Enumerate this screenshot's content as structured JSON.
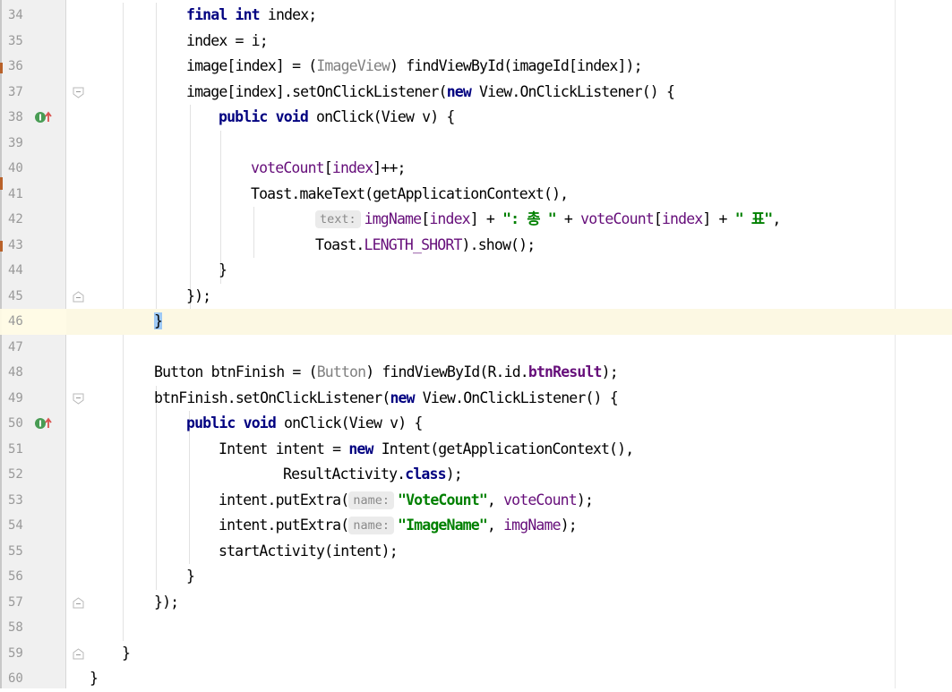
{
  "editor": {
    "language": "java",
    "caret_line": 46,
    "lines": [
      {
        "n": "34",
        "indent": 3,
        "tokens": [
          {
            "t": "final",
            "c": "k"
          },
          {
            "t": " "
          },
          {
            "t": "int",
            "c": "k"
          },
          {
            "t": " index;"
          }
        ]
      },
      {
        "n": "35",
        "indent": 3,
        "tokens": [
          {
            "t": "index = i;"
          }
        ]
      },
      {
        "n": "36",
        "indent": 3,
        "tokens": [
          {
            "t": "image[index] = ("
          },
          {
            "t": "ImageView",
            "c": "c"
          },
          {
            "t": ") findViewById(imageId[index]);"
          }
        ]
      },
      {
        "n": "37",
        "indent": 3,
        "fold": "open",
        "tokens": [
          {
            "t": "image[index].setOnClickListener("
          },
          {
            "t": "new",
            "c": "k"
          },
          {
            "t": " View.OnClickListener() {"
          }
        ]
      },
      {
        "n": "38",
        "indent": 4,
        "override": true,
        "tokens": [
          {
            "t": "public",
            "c": "k"
          },
          {
            "t": " "
          },
          {
            "t": "void",
            "c": "k"
          },
          {
            "t": " onClick(View v) {"
          }
        ]
      },
      {
        "n": "39",
        "indent": 0,
        "tokens": []
      },
      {
        "n": "40",
        "indent": 5,
        "tokens": [
          {
            "t": "voteCount",
            "c": "f"
          },
          {
            "t": "["
          },
          {
            "t": "index",
            "c": "f"
          },
          {
            "t": "]++;"
          }
        ]
      },
      {
        "n": "41",
        "indent": 5,
        "tokens": [
          {
            "t": "Toast.makeText(getApplicationContext(),"
          }
        ]
      },
      {
        "n": "42",
        "indent": 7,
        "tokens": [
          {
            "t": "text:",
            "c": "hint"
          },
          {
            "t": "imgName",
            "c": "f"
          },
          {
            "t": "["
          },
          {
            "t": "index",
            "c": "f"
          },
          {
            "t": "] + "
          },
          {
            "t": "\": 총 \"",
            "c": "s"
          },
          {
            "t": " + "
          },
          {
            "t": "voteCount",
            "c": "f"
          },
          {
            "t": "["
          },
          {
            "t": "index",
            "c": "f"
          },
          {
            "t": "] + "
          },
          {
            "t": "\" 표\"",
            "c": "s"
          },
          {
            "t": ","
          }
        ]
      },
      {
        "n": "43",
        "indent": 7,
        "tokens": [
          {
            "t": "Toast."
          },
          {
            "t": "LENGTH_SHORT",
            "c": "f"
          },
          {
            "t": ").show();"
          }
        ]
      },
      {
        "n": "44",
        "indent": 4,
        "tokens": [
          {
            "t": "}"
          }
        ]
      },
      {
        "n": "45",
        "indent": 3,
        "fold": "close",
        "tokens": [
          {
            "t": "});"
          }
        ]
      },
      {
        "n": "46",
        "indent": 2,
        "caret": true,
        "tokens": [
          {
            "t": "}",
            "c": "caret-brace"
          }
        ]
      },
      {
        "n": "47",
        "indent": 0,
        "tokens": []
      },
      {
        "n": "48",
        "indent": 2,
        "tokens": [
          {
            "t": "Button btnFinish = ("
          },
          {
            "t": "Button",
            "c": "c"
          },
          {
            "t": ") findViewById(R.id."
          },
          {
            "t": "btnResult",
            "c": "f k"
          },
          {
            "t": ");"
          }
        ]
      },
      {
        "n": "49",
        "indent": 2,
        "fold": "open",
        "tokens": [
          {
            "t": "btnFinish.setOnClickListener("
          },
          {
            "t": "new",
            "c": "k"
          },
          {
            "t": " View.OnClickListener() {"
          }
        ]
      },
      {
        "n": "50",
        "indent": 3,
        "override": true,
        "tokens": [
          {
            "t": "public",
            "c": "k"
          },
          {
            "t": " "
          },
          {
            "t": "void",
            "c": "k"
          },
          {
            "t": " onClick(View v) {"
          }
        ]
      },
      {
        "n": "51",
        "indent": 4,
        "tokens": [
          {
            "t": "Intent intent = "
          },
          {
            "t": "new",
            "c": "k"
          },
          {
            "t": " Intent(getApplicationContext(),"
          }
        ]
      },
      {
        "n": "52",
        "indent": 6,
        "tokens": [
          {
            "t": "ResultActivity."
          },
          {
            "t": "class",
            "c": "k"
          },
          {
            "t": ");"
          }
        ]
      },
      {
        "n": "53",
        "indent": 4,
        "tokens": [
          {
            "t": "intent.putExtra("
          },
          {
            "t": "name:",
            "c": "hint"
          },
          {
            "t": "\"VoteCount\"",
            "c": "s"
          },
          {
            "t": ", "
          },
          {
            "t": "voteCount",
            "c": "f"
          },
          {
            "t": ");"
          }
        ]
      },
      {
        "n": "54",
        "indent": 4,
        "tokens": [
          {
            "t": "intent.putExtra("
          },
          {
            "t": "name:",
            "c": "hint"
          },
          {
            "t": "\"ImageName\"",
            "c": "s"
          },
          {
            "t": ", "
          },
          {
            "t": "imgName",
            "c": "f"
          },
          {
            "t": ");"
          }
        ]
      },
      {
        "n": "55",
        "indent": 4,
        "tokens": [
          {
            "t": "startActivity(intent);"
          }
        ]
      },
      {
        "n": "56",
        "indent": 3,
        "tokens": [
          {
            "t": "}"
          }
        ]
      },
      {
        "n": "57",
        "indent": 2,
        "fold": "close",
        "tokens": [
          {
            "t": "});"
          }
        ]
      },
      {
        "n": "58",
        "indent": 0,
        "tokens": []
      },
      {
        "n": "59",
        "indent": 1,
        "fold": "close",
        "tokens": [
          {
            "t": "}"
          }
        ]
      },
      {
        "n": "60",
        "indent": 0,
        "tokens": [
          {
            "t": "}"
          }
        ]
      }
    ]
  },
  "colors": {
    "keyword": "#000080",
    "field": "#660e7a",
    "string": "#008000",
    "cast_hint": "#808080",
    "caret_row": "#fcf8e3",
    "gutter_bg": "#f0f0f0",
    "line_number": "#999999",
    "override_icon": "#499c54",
    "override_arrow": "#d9534f"
  },
  "icons": {
    "override": "implements-method-icon",
    "fold_open": "fold-expanded-icon",
    "fold_close": "fold-end-icon"
  }
}
